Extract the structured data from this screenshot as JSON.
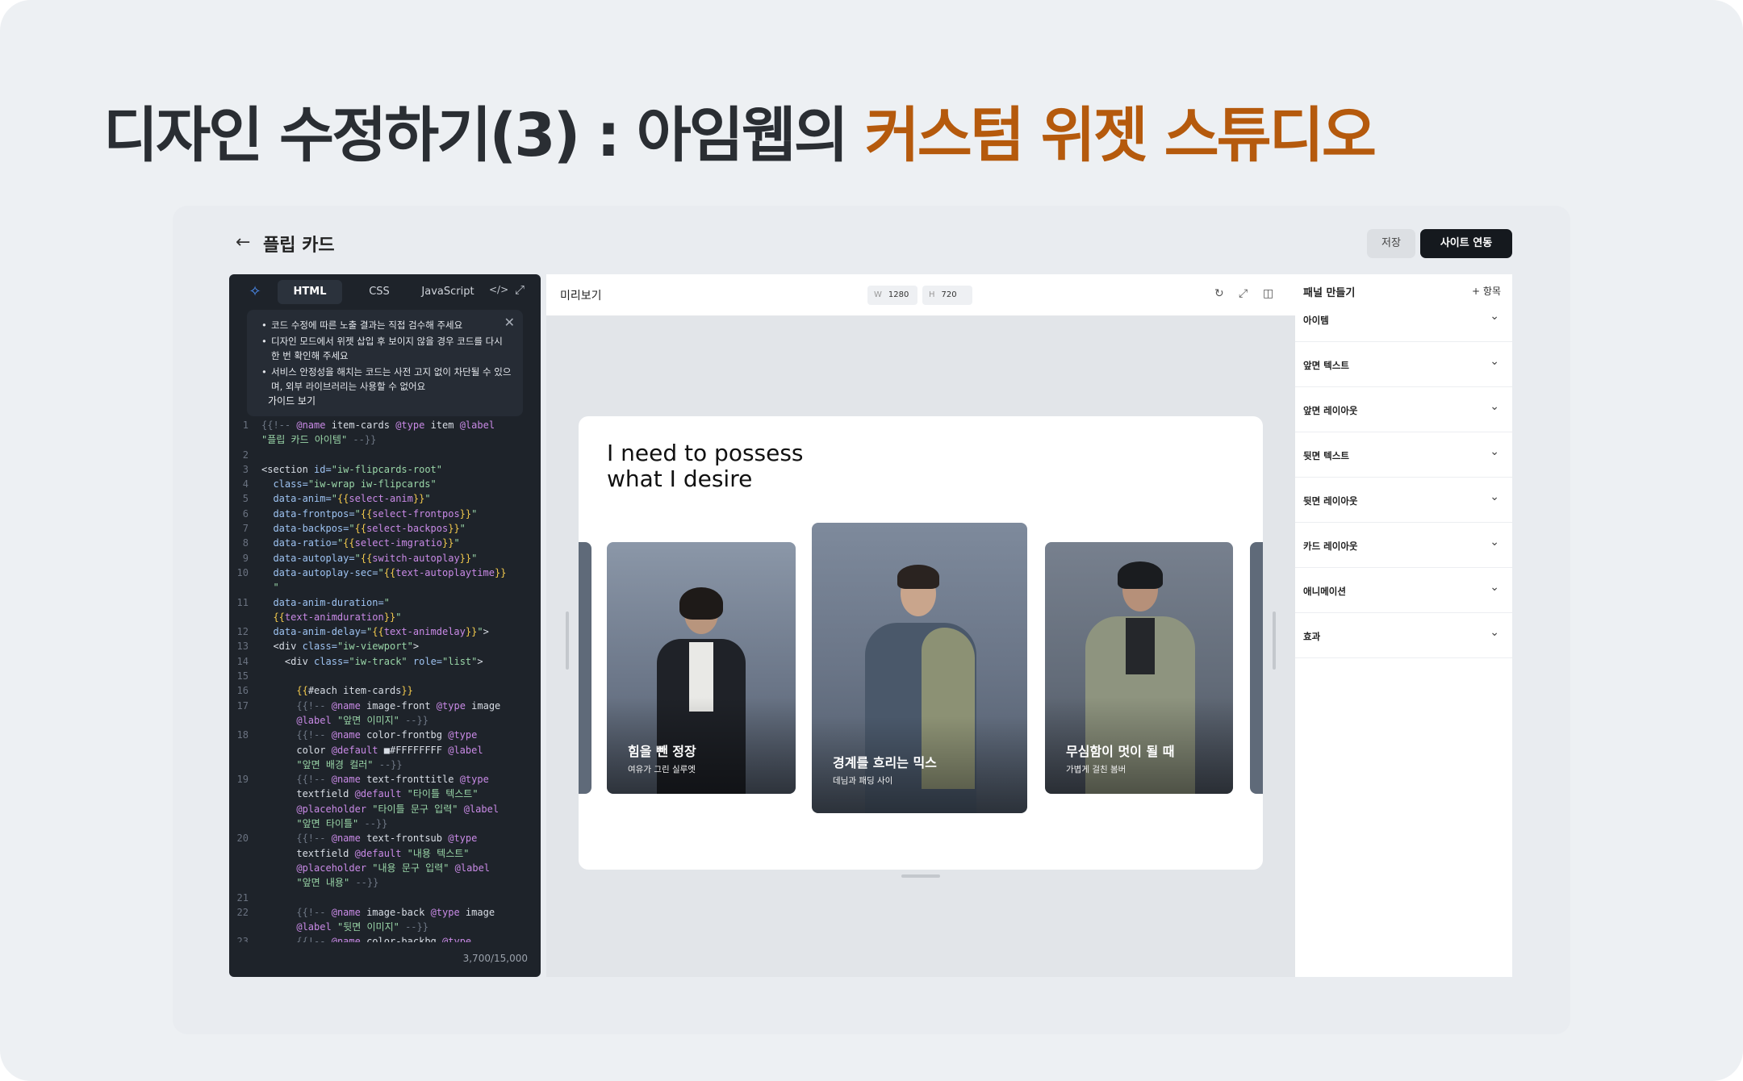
{
  "slide": {
    "headline_prefix": "디자인 수정하기(3) : 아임웹의 ",
    "headline_accent": "커스텀 위젯 스튜디오",
    "accent_color": "#b55a0d"
  },
  "topbar": {
    "back_icon": "arrow-left-icon",
    "title": "플립 카드",
    "save_label": "저장",
    "sync_label": "사이트 연동"
  },
  "editor": {
    "tabs": [
      "HTML",
      "CSS",
      "JavaScript"
    ],
    "active_tab": "HTML",
    "notice": [
      "코드 수정에 따른 노출 결과는 직접 검수해 주세요",
      "디자인 모드에서 위젯 삽입 후 보이지 않을 경우 코드를 다시 한 번 확인해 주세요",
      "서비스 안정성을 해치는 코드는 사전 고지 없이 차단될 수 있으며, 외부 라이브러리는 사용할 수 없어요"
    ],
    "guide_link": "가이드 보기",
    "counter": "3,700/15,000"
  },
  "preview": {
    "title": "미리보기",
    "width_label": "W",
    "width_value": "1280",
    "height_label": "H",
    "height_value": "720",
    "frame_title_1": "I need to possess",
    "frame_title_2": "what I desire",
    "cards": [
      {
        "title": "힘을 뺀 정장",
        "subtitle": "여유가 그린 실루엣"
      },
      {
        "title": "경계를 흐리는 믹스",
        "subtitle": "데님과 패딩 사이"
      },
      {
        "title": "무심함이 멋이 될 때",
        "subtitle": "가볍게 걸친 봄버"
      }
    ]
  },
  "side_panel": {
    "title": "패널 만들기",
    "add_label": "+ 항목",
    "sections": [
      "아이템",
      "앞면 텍스트",
      "앞면 레이아웃",
      "뒷면 텍스트",
      "뒷면 레이아웃",
      "카드 레이아웃",
      "애니메이션",
      "효과"
    ]
  }
}
